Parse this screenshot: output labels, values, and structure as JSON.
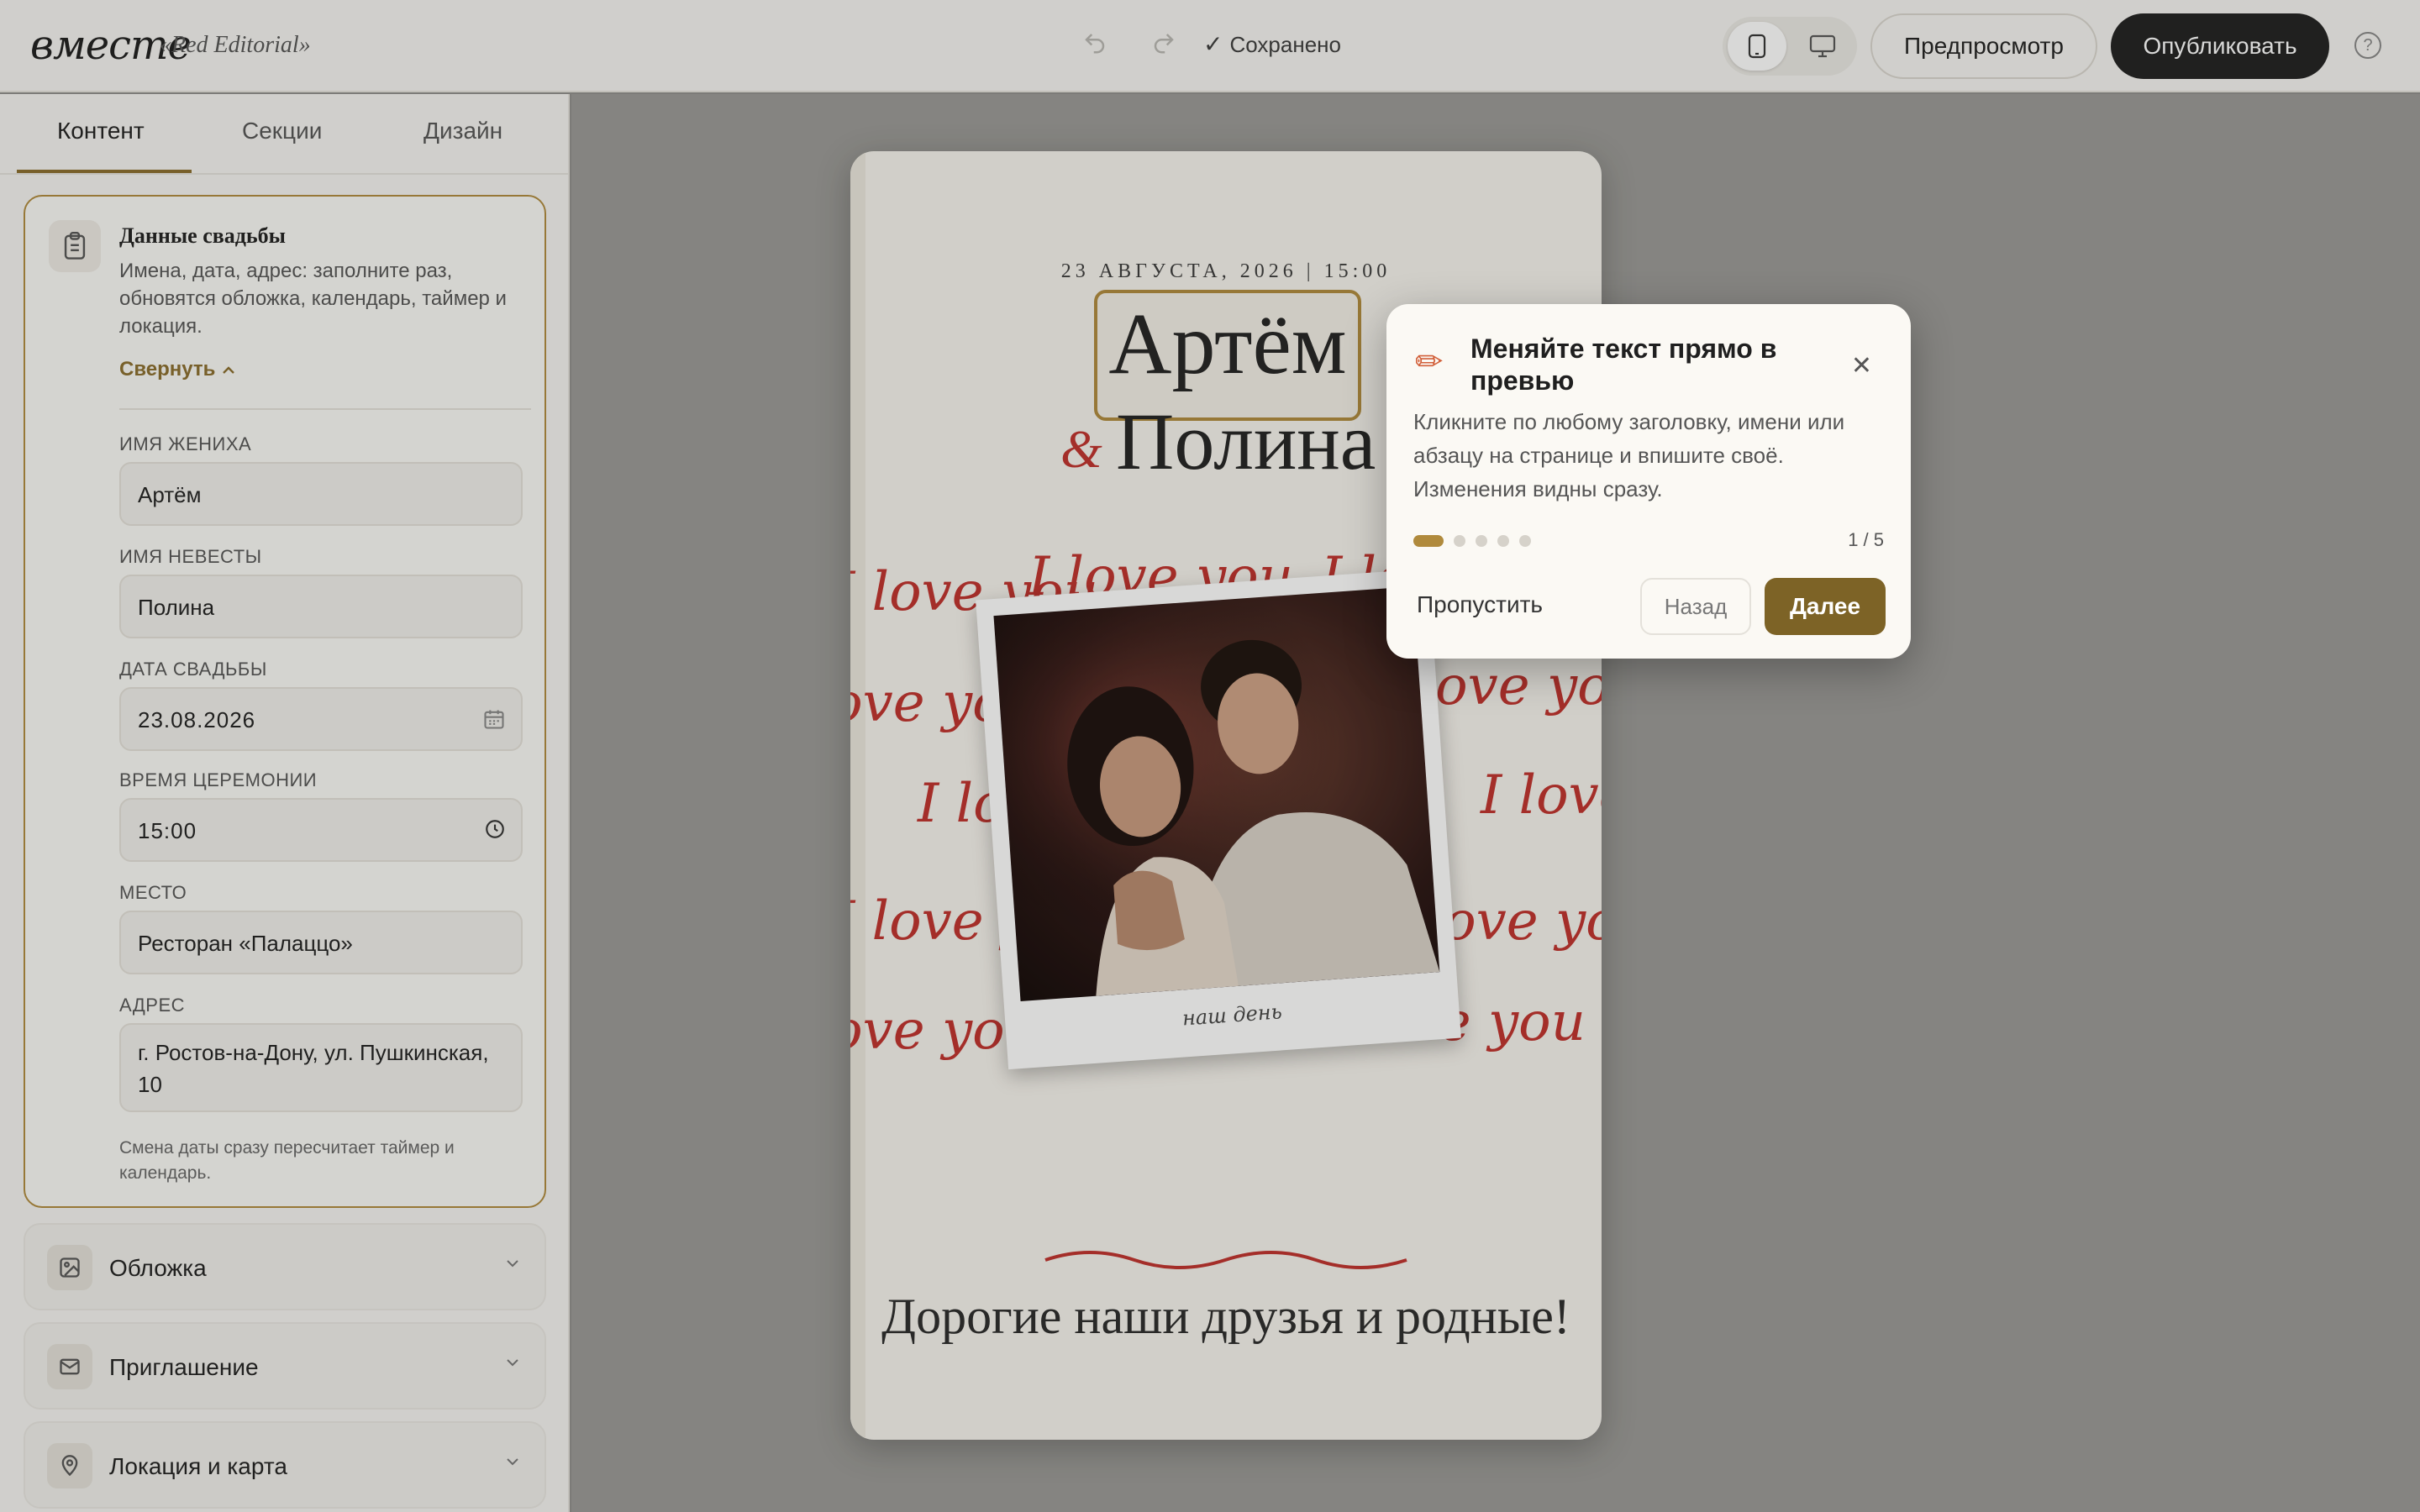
{
  "app": {
    "logo": "вместе",
    "template_name": "«Red Editorial»"
  },
  "topbar": {
    "saved_label": "Сохранено",
    "preview_label": "Предпросмотр",
    "publish_label": "Опубликовать",
    "help_symbol": "?"
  },
  "tabs": [
    {
      "label": "Контент",
      "active": true
    },
    {
      "label": "Секции",
      "active": false
    },
    {
      "label": "Дизайн",
      "active": false
    }
  ],
  "wedding_card": {
    "title": "Данные свадьбы",
    "description": "Имена, дата, адрес: заполните раз, обновятся обложка, календарь, таймер и локация.",
    "collapse_label": "Свернуть",
    "fields": [
      {
        "label": "ИМЯ ЖЕНИХА",
        "value": "Артём"
      },
      {
        "label": "ИМЯ НЕВЕСТЫ",
        "value": "Полина"
      },
      {
        "label": "ДАТА СВАДЬБЫ",
        "value": "23.08.2026"
      },
      {
        "label": "ВРЕМЯ ЦЕРЕМОНИИ",
        "value": "15:00"
      },
      {
        "label": "МЕСТО",
        "value": "Ресторан «Палаццо»"
      },
      {
        "label": "АДРЕС",
        "value": "г. Ростов-на-Дону, ул. Пушкинская, 10"
      }
    ],
    "note": "Смена даты сразу пересчитает таймер и календарь."
  },
  "accordions": [
    {
      "label": "Обложка",
      "icon": "image-icon"
    },
    {
      "label": "Приглашение",
      "icon": "mail-icon"
    },
    {
      "label": "Локация и карта",
      "icon": "map-pin-icon"
    }
  ],
  "invitation": {
    "date_line": "23 АВГУСТА, 2026  |  15:00",
    "name1": "Артём",
    "amp": "&",
    "name2": "Полина",
    "love_text": "I love you",
    "photo_caption": "наш день",
    "greeting": "Дорогие наши друзья и родные!",
    "accent_color": "#c0302b"
  },
  "tour": {
    "title": "Меняйте текст прямо в превью",
    "body": "Кликните по любому заголовку, имени или абзацу на странице и впишите своё. Изменения видны сразу.",
    "step_label": "1 / 5",
    "current_step": 1,
    "total_steps": 5,
    "skip_label": "Пропустить",
    "back_label": "Назад",
    "next_label": "Далее"
  },
  "colors": {
    "brand_gold": "#b08a3c",
    "next_button": "#7d6326",
    "dark": "#1f1f1f"
  }
}
